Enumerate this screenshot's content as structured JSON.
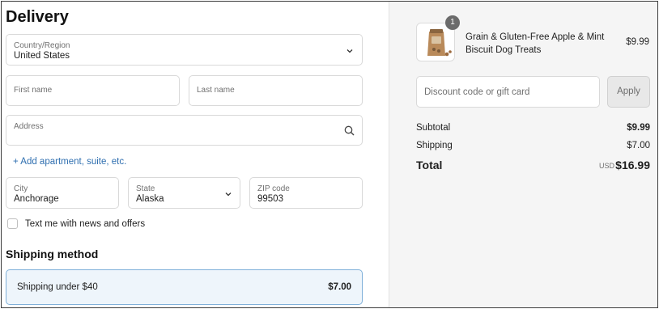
{
  "delivery": {
    "title": "Delivery",
    "country": {
      "label": "Country/Region",
      "value": "United States"
    },
    "first_name": {
      "label": "First name",
      "value": ""
    },
    "last_name": {
      "label": "Last name",
      "value": ""
    },
    "address": {
      "label": "Address",
      "value": ""
    },
    "add_apartment_link": "+ Add apartment, suite, etc.",
    "city": {
      "label": "City",
      "value": "Anchorage"
    },
    "state": {
      "label": "State",
      "value": "Alaska"
    },
    "zip": {
      "label": "ZIP code",
      "value": "99503"
    },
    "sms_optin_label": "Text me with news and offers"
  },
  "shipping_method": {
    "title": "Shipping method",
    "option_name": "Shipping under $40",
    "option_price": "$7.00"
  },
  "summary": {
    "item": {
      "quantity": "1",
      "name": "Grain & Gluten-Free Apple & Mint Biscuit Dog Treats",
      "price": "$9.99"
    },
    "discount_placeholder": "Discount code or gift card",
    "apply_label": "Apply",
    "subtotal_label": "Subtotal",
    "subtotal_value": "$9.99",
    "shipping_label": "Shipping",
    "shipping_value": "$7.00",
    "total_label": "Total",
    "currency": "USD",
    "total_value": "$16.99"
  },
  "icons": {
    "chevron": "chevron-down-icon",
    "search": "search-icon"
  }
}
